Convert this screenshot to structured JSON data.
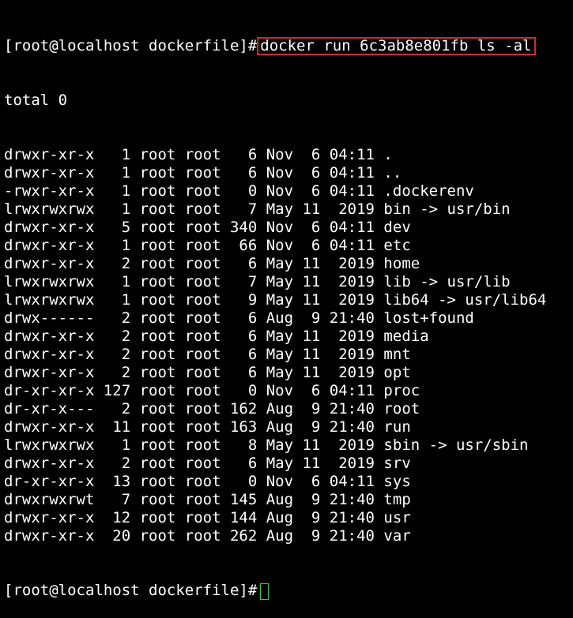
{
  "terminal": {
    "prompt": "[root@localhost dockerfile]#",
    "command": "docker run 6c3ab8e801fb ls -al",
    "total": "total 0",
    "entries": [
      "drwxr-xr-x   1 root root   6 Nov  6 04:11 .",
      "drwxr-xr-x   1 root root   6 Nov  6 04:11 ..",
      "-rwxr-xr-x   1 root root   0 Nov  6 04:11 .dockerenv",
      "lrwxrwxrwx   1 root root   7 May 11  2019 bin -> usr/bin",
      "drwxr-xr-x   5 root root 340 Nov  6 04:11 dev",
      "drwxr-xr-x   1 root root  66 Nov  6 04:11 etc",
      "drwxr-xr-x   2 root root   6 May 11  2019 home",
      "lrwxrwxrwx   1 root root   7 May 11  2019 lib -> usr/lib",
      "lrwxrwxrwx   1 root root   9 May 11  2019 lib64 -> usr/lib64",
      "drwx------   2 root root   6 Aug  9 21:40 lost+found",
      "drwxr-xr-x   2 root root   6 May 11  2019 media",
      "drwxr-xr-x   2 root root   6 May 11  2019 mnt",
      "drwxr-xr-x   2 root root   6 May 11  2019 opt",
      "dr-xr-xr-x 127 root root   0 Nov  6 04:11 proc",
      "dr-xr-x---   2 root root 162 Aug  9 21:40 root",
      "drwxr-xr-x  11 root root 163 Aug  9 21:40 run",
      "lrwxrwxrwx   1 root root   8 May 11  2019 sbin -> usr/sbin",
      "drwxr-xr-x   2 root root   6 May 11  2019 srv",
      "dr-xr-xr-x  13 root root   0 Nov  6 04:11 sys",
      "drwxrwxrwt   7 root root 145 Aug  9 21:40 tmp",
      "drwxr-xr-x  12 root root 144 Aug  9 21:40 usr",
      "drwxr-xr-x  20 root root 262 Aug  9 21:40 var"
    ],
    "final_prompt": "[root@localhost dockerfile]#",
    "colors": {
      "background": "#000000",
      "text": "#ffffff",
      "highlight_box": "#d8262a",
      "cursor": "#2fd12f"
    }
  }
}
